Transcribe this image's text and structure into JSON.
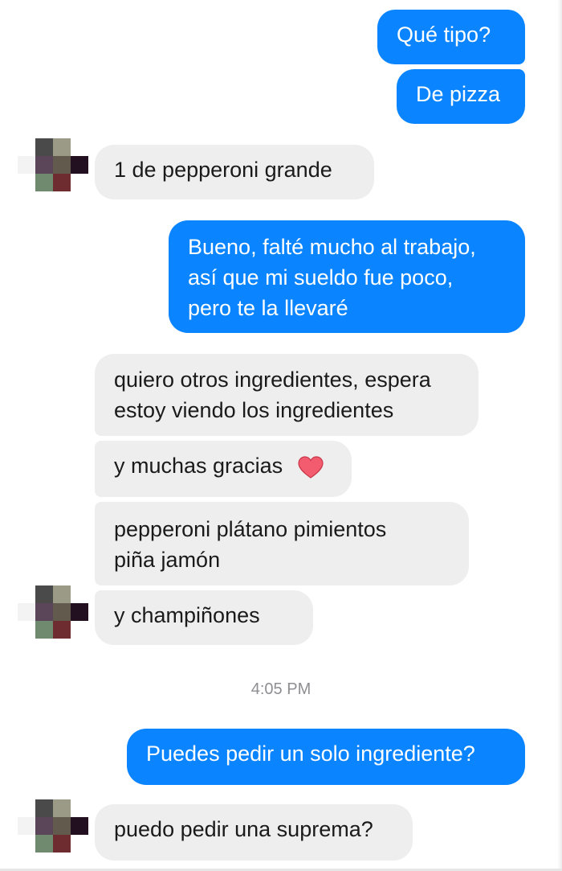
{
  "conversation": {
    "messages": [
      {
        "id": "m1",
        "sender": "me",
        "text": "Qué tipo?"
      },
      {
        "id": "m2",
        "sender": "me",
        "text": "De pizza"
      },
      {
        "id": "m3",
        "sender": "other",
        "text": "1 de pepperoni grande"
      },
      {
        "id": "m4",
        "sender": "me",
        "lines": [
          "Bueno, falté mucho al trabajo,",
          "así que mi sueldo fue poco,",
          "pero te la llevaré"
        ]
      },
      {
        "id": "m5",
        "sender": "other",
        "lines": [
          "quiero otros ingredientes, espera",
          "estoy viendo los ingredientes"
        ]
      },
      {
        "id": "m6",
        "sender": "other",
        "text": "y muchas gracias",
        "emoji": "heart-icon"
      },
      {
        "id": "m7",
        "sender": "other",
        "lines": [
          "pepperoni plátano pimientos",
          "piña jamón"
        ]
      },
      {
        "id": "m8",
        "sender": "other",
        "text": "y champiñones"
      },
      {
        "id": "m9",
        "sender": "me",
        "text": "Puedes pedir un solo ingrediente?"
      },
      {
        "id": "m10",
        "sender": "other",
        "text": "puedo pedir una suprema?"
      }
    ],
    "timestamp": "4:05 PM"
  },
  "avatar": {
    "icon": "pixelated-avatar-icon",
    "colors": [
      "#4a4a4a",
      "#9a9a86",
      "#ffffff",
      "#5a4658",
      "#625a4c",
      "#221020",
      "#6f8a6e",
      "#6e2c30",
      "#ffffff"
    ]
  },
  "colors": {
    "outgoing_bubble": "#0a84ff",
    "incoming_bubble": "#eeeeef",
    "timestamp": "#8e8e93",
    "heart": "#f25c6e"
  }
}
